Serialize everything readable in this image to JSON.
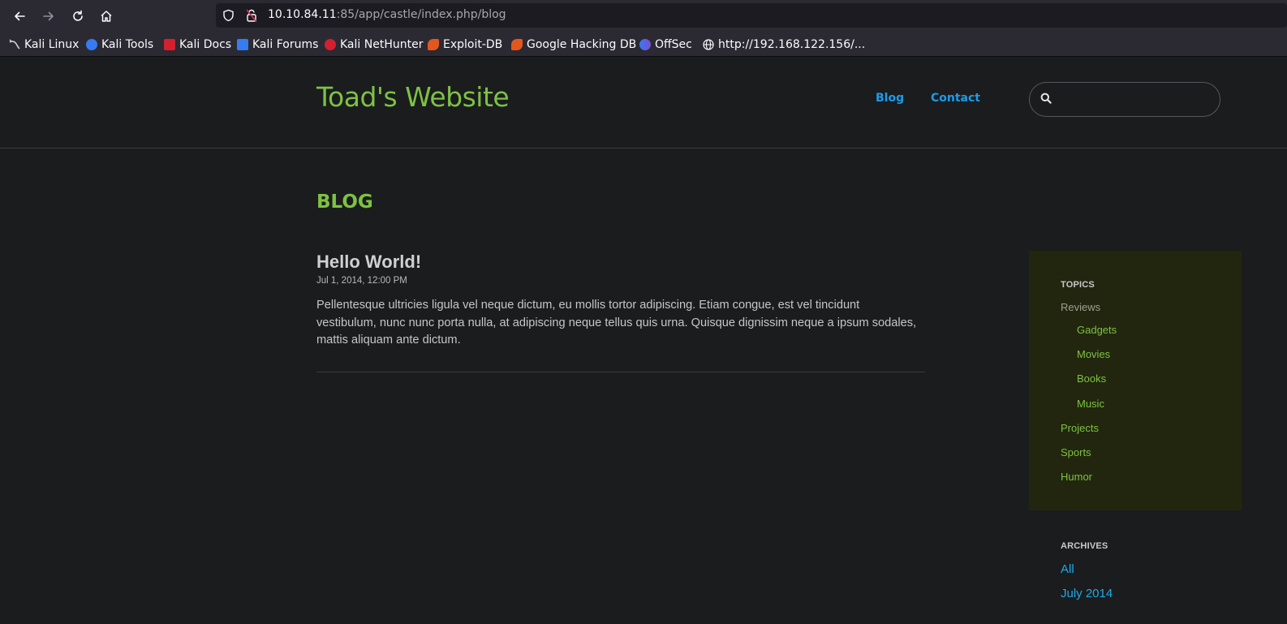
{
  "browser": {
    "url_host": "10.10.84.11",
    "url_rest": ":85/app/castle/index.php/blog",
    "bookmarks": [
      {
        "label": "Kali Linux",
        "icon": "kali-dragon-icon",
        "color": "#cfcfcf"
      },
      {
        "label": "Kali Tools",
        "icon": "kali-tools-icon",
        "color": "#367bf0"
      },
      {
        "label": "Kali Docs",
        "icon": "kali-docs-icon",
        "color": "#d2202f"
      },
      {
        "label": "Kali Forums",
        "icon": "kali-forums-icon",
        "color": "#367bf0"
      },
      {
        "label": "Kali NetHunter",
        "icon": "nethunter-icon",
        "color": "#d2202f"
      },
      {
        "label": "Exploit-DB",
        "icon": "exploit-db-icon",
        "color": "#e2571e"
      },
      {
        "label": "Google Hacking DB",
        "icon": "ghdb-icon",
        "color": "#e2571e"
      },
      {
        "label": "OffSec",
        "icon": "offsec-icon",
        "color": "#5b5fc7"
      },
      {
        "label": "http://192.168.122.156/...",
        "icon": "globe-icon",
        "color": "#fbfbfe"
      }
    ]
  },
  "site": {
    "title": "Toad's Website",
    "nav": {
      "blog": "Blog",
      "contact": "Contact"
    },
    "search_placeholder": ""
  },
  "main": {
    "heading": "BLOG",
    "post": {
      "title": "Hello World!",
      "date": "Jul 1, 2014, 12:00 PM",
      "body": "Pellentesque ultricies ligula vel neque dictum, eu mollis tortor adipiscing. Etiam congue, est vel tincidunt vestibulum, nunc nunc porta nulla, at adipiscing neque tellus quis urna. Quisque dignissim neque a ipsum sodales, mattis aliquam ante dictum."
    }
  },
  "sidebar": {
    "topics_heading": "TOPICS",
    "topics": [
      "Reviews",
      "Gadgets",
      "Movies",
      "Books",
      "Music",
      "Projects",
      "Sports",
      "Humor"
    ],
    "archives_heading": "ARCHIVES",
    "archives": [
      "All",
      "July 2014"
    ]
  },
  "colors": {
    "accent_green": "#7dc242",
    "link_blue": "#1e9be8",
    "page_bg": "#1b1c1e",
    "topics_bg": "#22260f"
  }
}
